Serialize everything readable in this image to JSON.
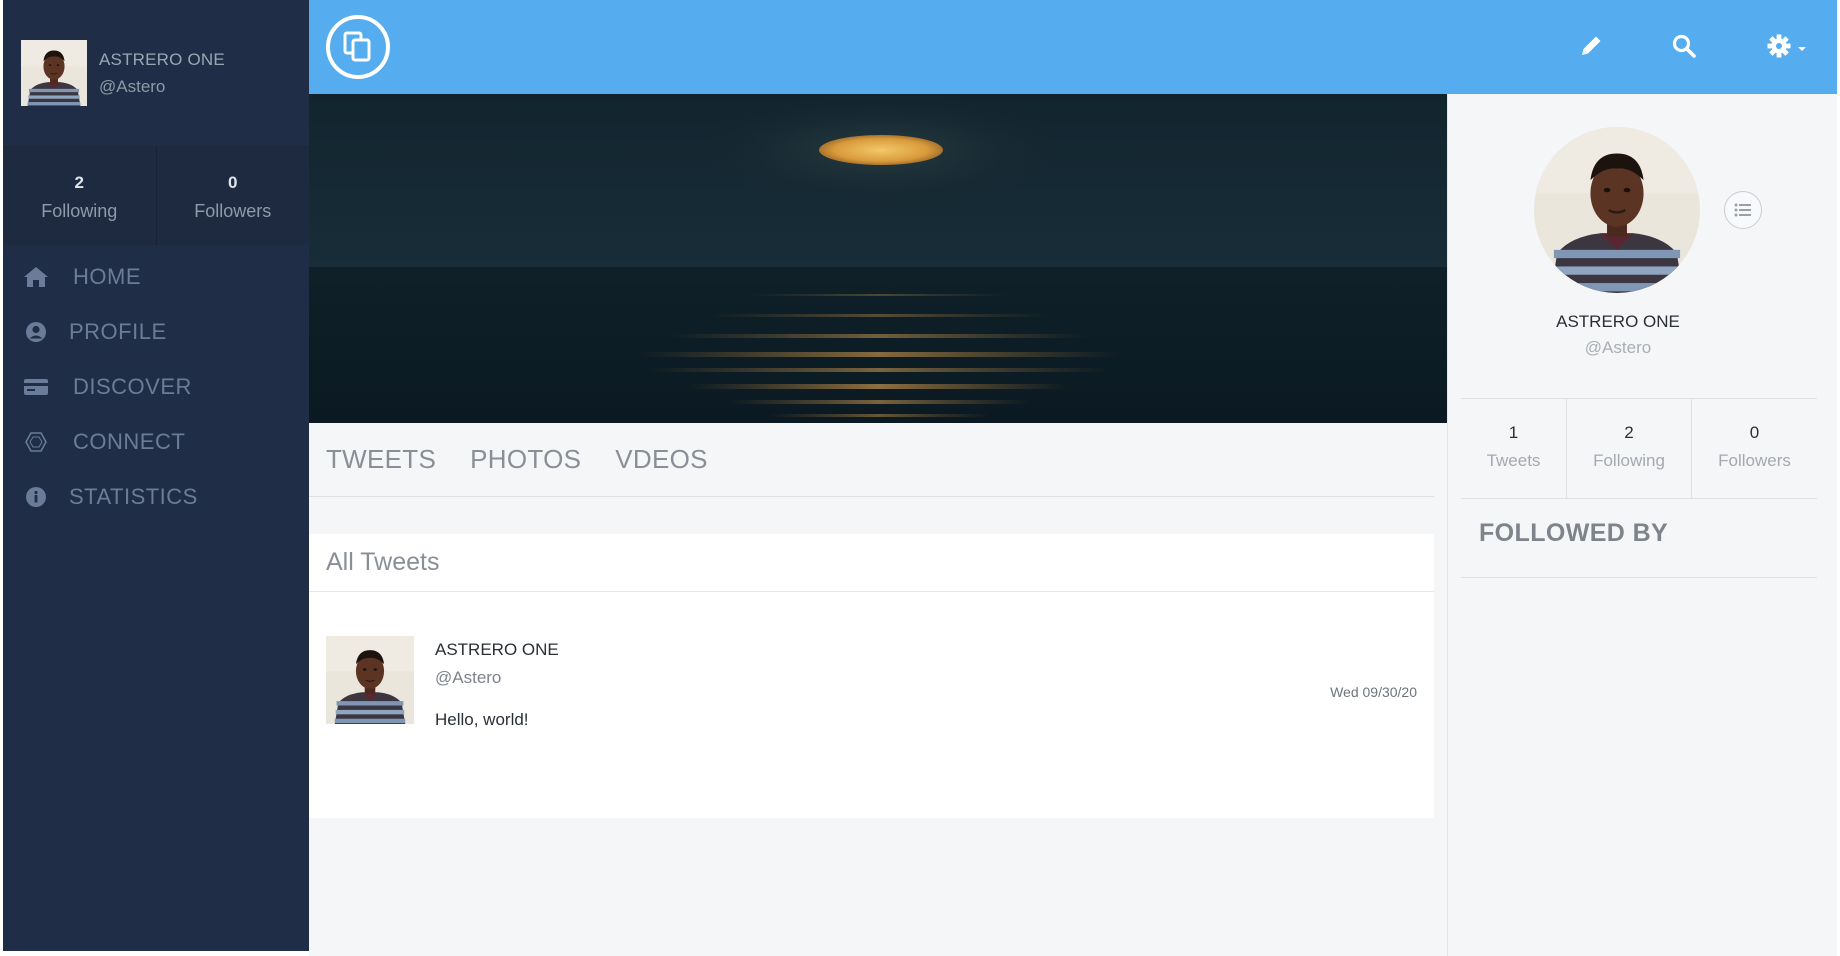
{
  "user": {
    "name": "ASTRERO ONE",
    "handle": "@Astero"
  },
  "sidebar": {
    "stats": [
      {
        "value": "2",
        "label": "Following"
      },
      {
        "value": "0",
        "label": "Followers"
      }
    ],
    "nav": [
      {
        "label": "HOME",
        "icon": "home-icon"
      },
      {
        "label": "PROFILE",
        "icon": "user-circle-icon"
      },
      {
        "label": "DISCOVER",
        "icon": "credit-card-icon"
      },
      {
        "label": "CONNECT",
        "icon": "hexagon-icon"
      },
      {
        "label": "STATISTICS",
        "icon": "info-icon"
      }
    ]
  },
  "topbar": {
    "logo_icon": "clone-logo-icon",
    "icons": [
      "pencil-icon",
      "search-icon",
      "gear-icon"
    ]
  },
  "tabs": [
    "TWEETS",
    "PHOTOS",
    "VDEOS"
  ],
  "tweets_panel": {
    "title": "All Tweets",
    "tweets": [
      {
        "name": "ASTRERO ONE",
        "handle": "@Astero",
        "text": "Hello, world!",
        "date": "Wed 09/30/20"
      }
    ]
  },
  "profile_panel": {
    "stats": [
      {
        "value": "1",
        "label": "Tweets"
      },
      {
        "value": "2",
        "label": "Following"
      },
      {
        "value": "0",
        "label": "Followers"
      }
    ],
    "followed_by_title": "FOLLOWED BY"
  },
  "colors": {
    "sidebar_bg": "#1f2e46",
    "topbar_bg": "#55acee",
    "nav_text": "#6a7c97",
    "main_bg": "#f5f6f8"
  }
}
